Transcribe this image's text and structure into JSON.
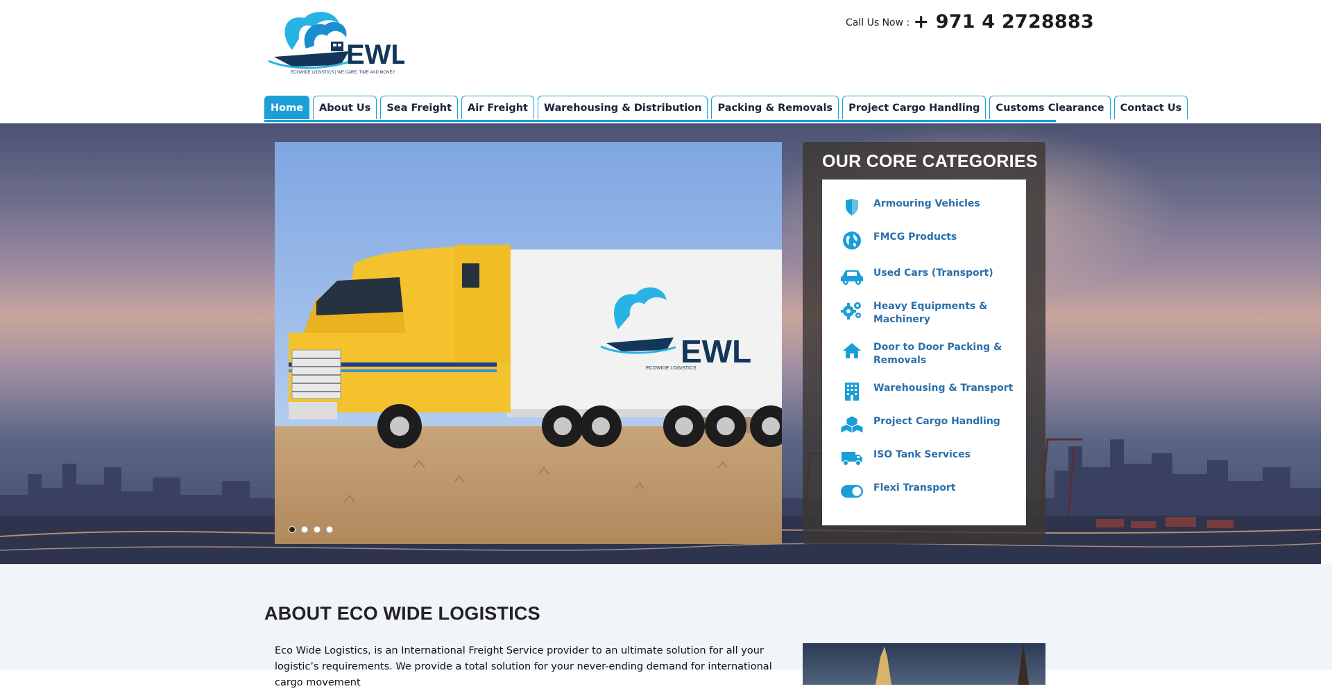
{
  "header": {
    "logo": {
      "text": "EWL",
      "tagline": "ECOWIDE LOGISTICS | WE CARE, TIME AND MONEY"
    },
    "phone": {
      "label": "Call Us Now :",
      "number": "+ 971 4 2728883"
    }
  },
  "nav": {
    "items": [
      {
        "label": "Home",
        "active": true
      },
      {
        "label": "About Us"
      },
      {
        "label": "Sea Freight"
      },
      {
        "label": "Air Freight"
      },
      {
        "label": "Warehousing & Distribution"
      },
      {
        "label": "Packing & Removals"
      },
      {
        "label": "Project Cargo Handling"
      },
      {
        "label": "Customs Clearance"
      },
      {
        "label": "Contact Us"
      }
    ]
  },
  "slider": {
    "truck_logo_text": "EWL",
    "truck_logo_sub": "ECOWIDE LOGISTICS",
    "slide_count": 4,
    "active_slide": 1
  },
  "core": {
    "title": "OUR CORE CATEGORIES",
    "items": [
      {
        "label": "Armouring Vehicles",
        "icon": "shield-icon"
      },
      {
        "label": "FMCG Products",
        "icon": "globe-icon"
      },
      {
        "label": "Used Cars (Transport)",
        "icon": "car-icon"
      },
      {
        "label": "Heavy Equipments & Machinery",
        "icon": "gears-icon"
      },
      {
        "label": "Door to Door Packing & Removals",
        "icon": "home-icon"
      },
      {
        "label": "Warehousing & Transport",
        "icon": "building-icon"
      },
      {
        "label": "Project Cargo Handling",
        "icon": "cubes-icon"
      },
      {
        "label": "ISO Tank Services",
        "icon": "truck-icon"
      },
      {
        "label": "Flexi Transport",
        "icon": "toggle-icon"
      }
    ]
  },
  "about": {
    "title": "ABOUT ECO WIDE LOGISTICS",
    "text": "Eco Wide Logistics, is an International Freight Service provider to an ultimate solution for all your logistic’s requirements. We provide a total solution for your never-ending demand for international cargo movement"
  },
  "colors": {
    "accent": "#1aa0d6",
    "navy": "#17263a",
    "link": "#2a6fab"
  }
}
